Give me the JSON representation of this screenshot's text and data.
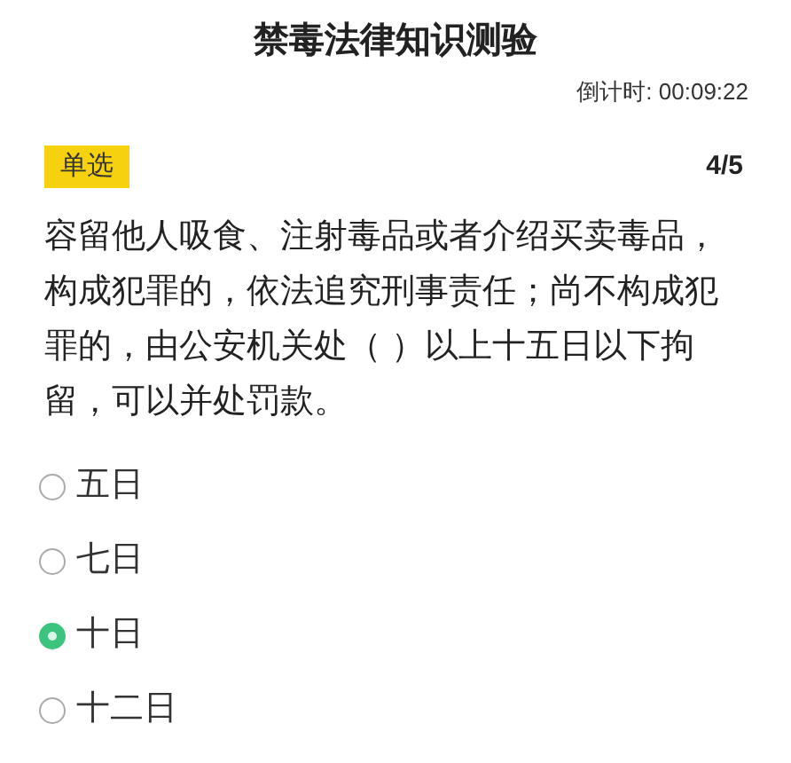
{
  "title": "禁毒法律知识测验",
  "timer": "倒计时: 00:09:22",
  "question_type": "单选",
  "progress": "4/5",
  "question": "容留他人吸食、注射毒品或者介绍买卖毒品，构成犯罪的，依法追究刑事责任；尚不构成犯罪的，由公安机关处（ ）以上十五日以下拘留，可以并处罚款。",
  "options": [
    {
      "label": "五日",
      "selected": false
    },
    {
      "label": "七日",
      "selected": false
    },
    {
      "label": "十日",
      "selected": true
    },
    {
      "label": "十二日",
      "selected": false
    }
  ]
}
